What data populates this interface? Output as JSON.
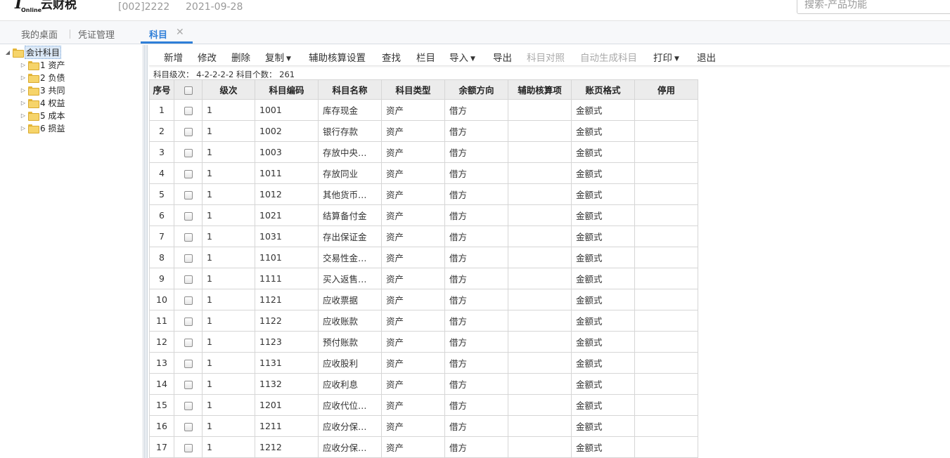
{
  "header": {
    "logo_mark": "T",
    "logo_online": "Online",
    "logo_text": "云财税",
    "account": "[002]2222",
    "date": "2021-09-28",
    "search_placeholder": "搜索-产品功能"
  },
  "tabs": [
    {
      "label": "我的桌面"
    },
    {
      "label": "凭证管理"
    },
    {
      "label": "科目",
      "active": true
    }
  ],
  "tab_close": "✕",
  "tree": {
    "root": "会计科目",
    "children": [
      "1 资产",
      "2 负债",
      "3 共同",
      "4 权益",
      "5 成本",
      "6 损益"
    ]
  },
  "toolbar": {
    "add": "新增",
    "edit": "修改",
    "delete": "删除",
    "copy": "复制",
    "aux_setup": "辅助核算设置",
    "find": "查找",
    "columns": "栏目",
    "import": "导入",
    "export": "导出",
    "compare": "科目对照",
    "auto_gen": "自动生成科目",
    "print": "打印",
    "exit": "退出"
  },
  "level_info": "科目级次： 4-2-2-2-2   科目个数： 261",
  "table": {
    "headers": [
      "序号",
      "",
      "级次",
      "科目编码",
      "科目名称",
      "科目类型",
      "余额方向",
      "辅助核算项",
      "账页格式",
      "停用"
    ],
    "rows": [
      [
        "1",
        "1",
        "1001",
        "库存现金",
        "资产",
        "借方",
        "",
        "金额式",
        ""
      ],
      [
        "2",
        "1",
        "1002",
        "银行存款",
        "资产",
        "借方",
        "",
        "金额式",
        ""
      ],
      [
        "3",
        "1",
        "1003",
        "存放中央…",
        "资产",
        "借方",
        "",
        "金额式",
        ""
      ],
      [
        "4",
        "1",
        "1011",
        "存放同业",
        "资产",
        "借方",
        "",
        "金额式",
        ""
      ],
      [
        "5",
        "1",
        "1012",
        "其他货币…",
        "资产",
        "借方",
        "",
        "金额式",
        ""
      ],
      [
        "6",
        "1",
        "1021",
        "结算备付金",
        "资产",
        "借方",
        "",
        "金额式",
        ""
      ],
      [
        "7",
        "1",
        "1031",
        "存出保证金",
        "资产",
        "借方",
        "",
        "金额式",
        ""
      ],
      [
        "8",
        "1",
        "1101",
        "交易性金…",
        "资产",
        "借方",
        "",
        "金额式",
        ""
      ],
      [
        "9",
        "1",
        "1111",
        "买入返售…",
        "资产",
        "借方",
        "",
        "金额式",
        ""
      ],
      [
        "10",
        "1",
        "1121",
        "应收票据",
        "资产",
        "借方",
        "",
        "金额式",
        ""
      ],
      [
        "11",
        "1",
        "1122",
        "应收账款",
        "资产",
        "借方",
        "",
        "金额式",
        ""
      ],
      [
        "12",
        "1",
        "1123",
        "预付账款",
        "资产",
        "借方",
        "",
        "金额式",
        ""
      ],
      [
        "13",
        "1",
        "1131",
        "应收股利",
        "资产",
        "借方",
        "",
        "金额式",
        ""
      ],
      [
        "14",
        "1",
        "1132",
        "应收利息",
        "资产",
        "借方",
        "",
        "金额式",
        ""
      ],
      [
        "15",
        "1",
        "1201",
        "应收代位…",
        "资产",
        "借方",
        "",
        "金额式",
        ""
      ],
      [
        "16",
        "1",
        "1211",
        "应收分保…",
        "资产",
        "借方",
        "",
        "金额式",
        ""
      ],
      [
        "17",
        "1",
        "1212",
        "应收分保…",
        "资产",
        "借方",
        "",
        "金额式",
        ""
      ]
    ]
  }
}
